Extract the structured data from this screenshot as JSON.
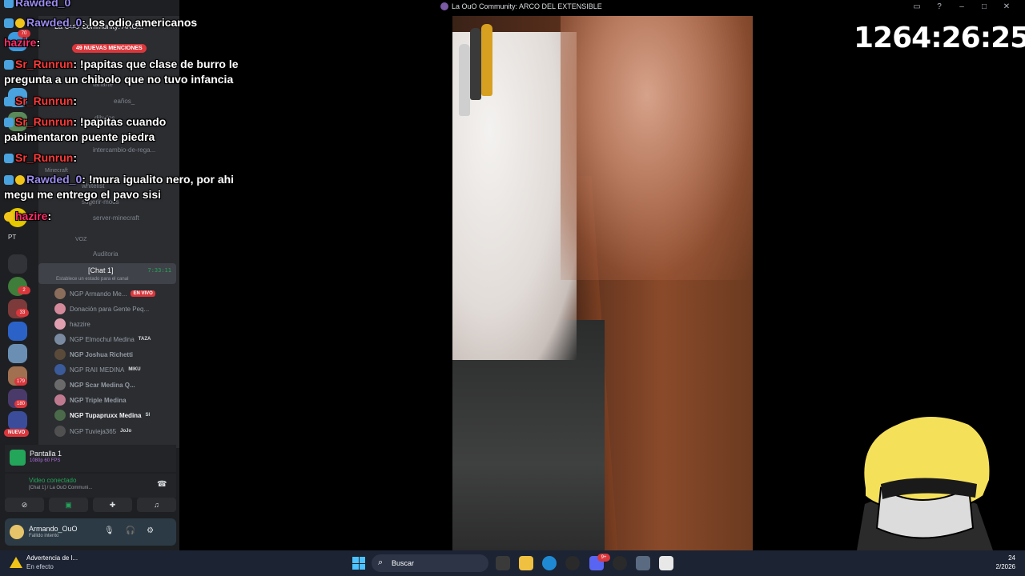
{
  "window": {
    "title": "La OuO Community: ARCO DEL EXTENSIBLE"
  },
  "timer": "1264:26:25",
  "chat": [
    {
      "user": "Rawded_0",
      "text": "los odio americanos"
    },
    {
      "user": "hazire",
      "text": ""
    },
    {
      "user": "Sr_Runrun",
      "text": "!papitas que clase de burro le pregunta a un chibolo que no tuvo infancia"
    },
    {
      "user": "Sr_Runrun",
      "text": ""
    },
    {
      "user": "Sr_Runrun",
      "text": "!papitas cuando pabimentaron puente piedra"
    },
    {
      "user": "Sr_Runrun",
      "text": ""
    },
    {
      "user": "Rawded_0",
      "text": "!mura igualito nero, por ahi megu me entrego el pavo sisi"
    },
    {
      "user": "hazire",
      "text": ""
    }
  ],
  "discord": {
    "server_name": "La OuO Community: ARC...",
    "mentions_badge": "49 NUEVAS MENCIONES",
    "channels": [
      {
        "label": "tanarte"
      },
      {
        "label": "eaños_"
      },
      {
        "label": "dibujos"
      },
      {
        "label": "intercambio-de-rega..."
      },
      {
        "label": "Minecraft",
        "category": true
      },
      {
        "label": "whitelist"
      },
      {
        "label": "sugerir-mods"
      },
      {
        "label": "server-minecraft"
      },
      {
        "label": "VOZ",
        "category": true
      },
      {
        "label": "Auditoria"
      }
    ],
    "voice_channel": {
      "name": "[Chat 1]",
      "time": "7:33:11",
      "status": "Establece un estado para el canal"
    },
    "members": [
      {
        "name": "NGP Armando Me...",
        "live": "EN VIVO"
      },
      {
        "name": "Donación para Gente Peq..."
      },
      {
        "name": "hazzire"
      },
      {
        "name": "NGP Elmochul Medina",
        "tag": "TAZA"
      },
      {
        "name": "NGP Joshua Richetti"
      },
      {
        "name": "NGP RAII MEDINA",
        "tag": "MIKU"
      },
      {
        "name": "NGP Scar Medina Q..."
      },
      {
        "name": "NGP Triple Medina"
      },
      {
        "name": "NGP Tupapruxx Medina",
        "tag": "SI"
      },
      {
        "name": "NGP Tuvieja365",
        "tag": "JoJo"
      }
    ],
    "guild_badges": [
      "70",
      "2",
      "33",
      "179",
      "180"
    ],
    "new_label": "NUEVO",
    "pt_label": "PT",
    "screen_share": {
      "title": "Pantalla 1",
      "sub": "1080p 60 FPS"
    },
    "voice_connected": {
      "title": "Video conectado",
      "sub": "[Chat 1] / La OuO Communi..."
    },
    "user": {
      "name": "Armando_OuO",
      "status": "Fallido intento"
    }
  },
  "taskbar": {
    "notification_title": "Advertencia de l...",
    "notification_sub": "En efecto",
    "search_placeholder": "Buscar",
    "clock_time": "24",
    "clock_date": "2/2026",
    "discord_badge": "9+"
  },
  "colors": {
    "discord_accent": "#5865f2",
    "live_red": "#da373c",
    "online_green": "#23a55a",
    "taskbar_bg": "#1c2333"
  }
}
